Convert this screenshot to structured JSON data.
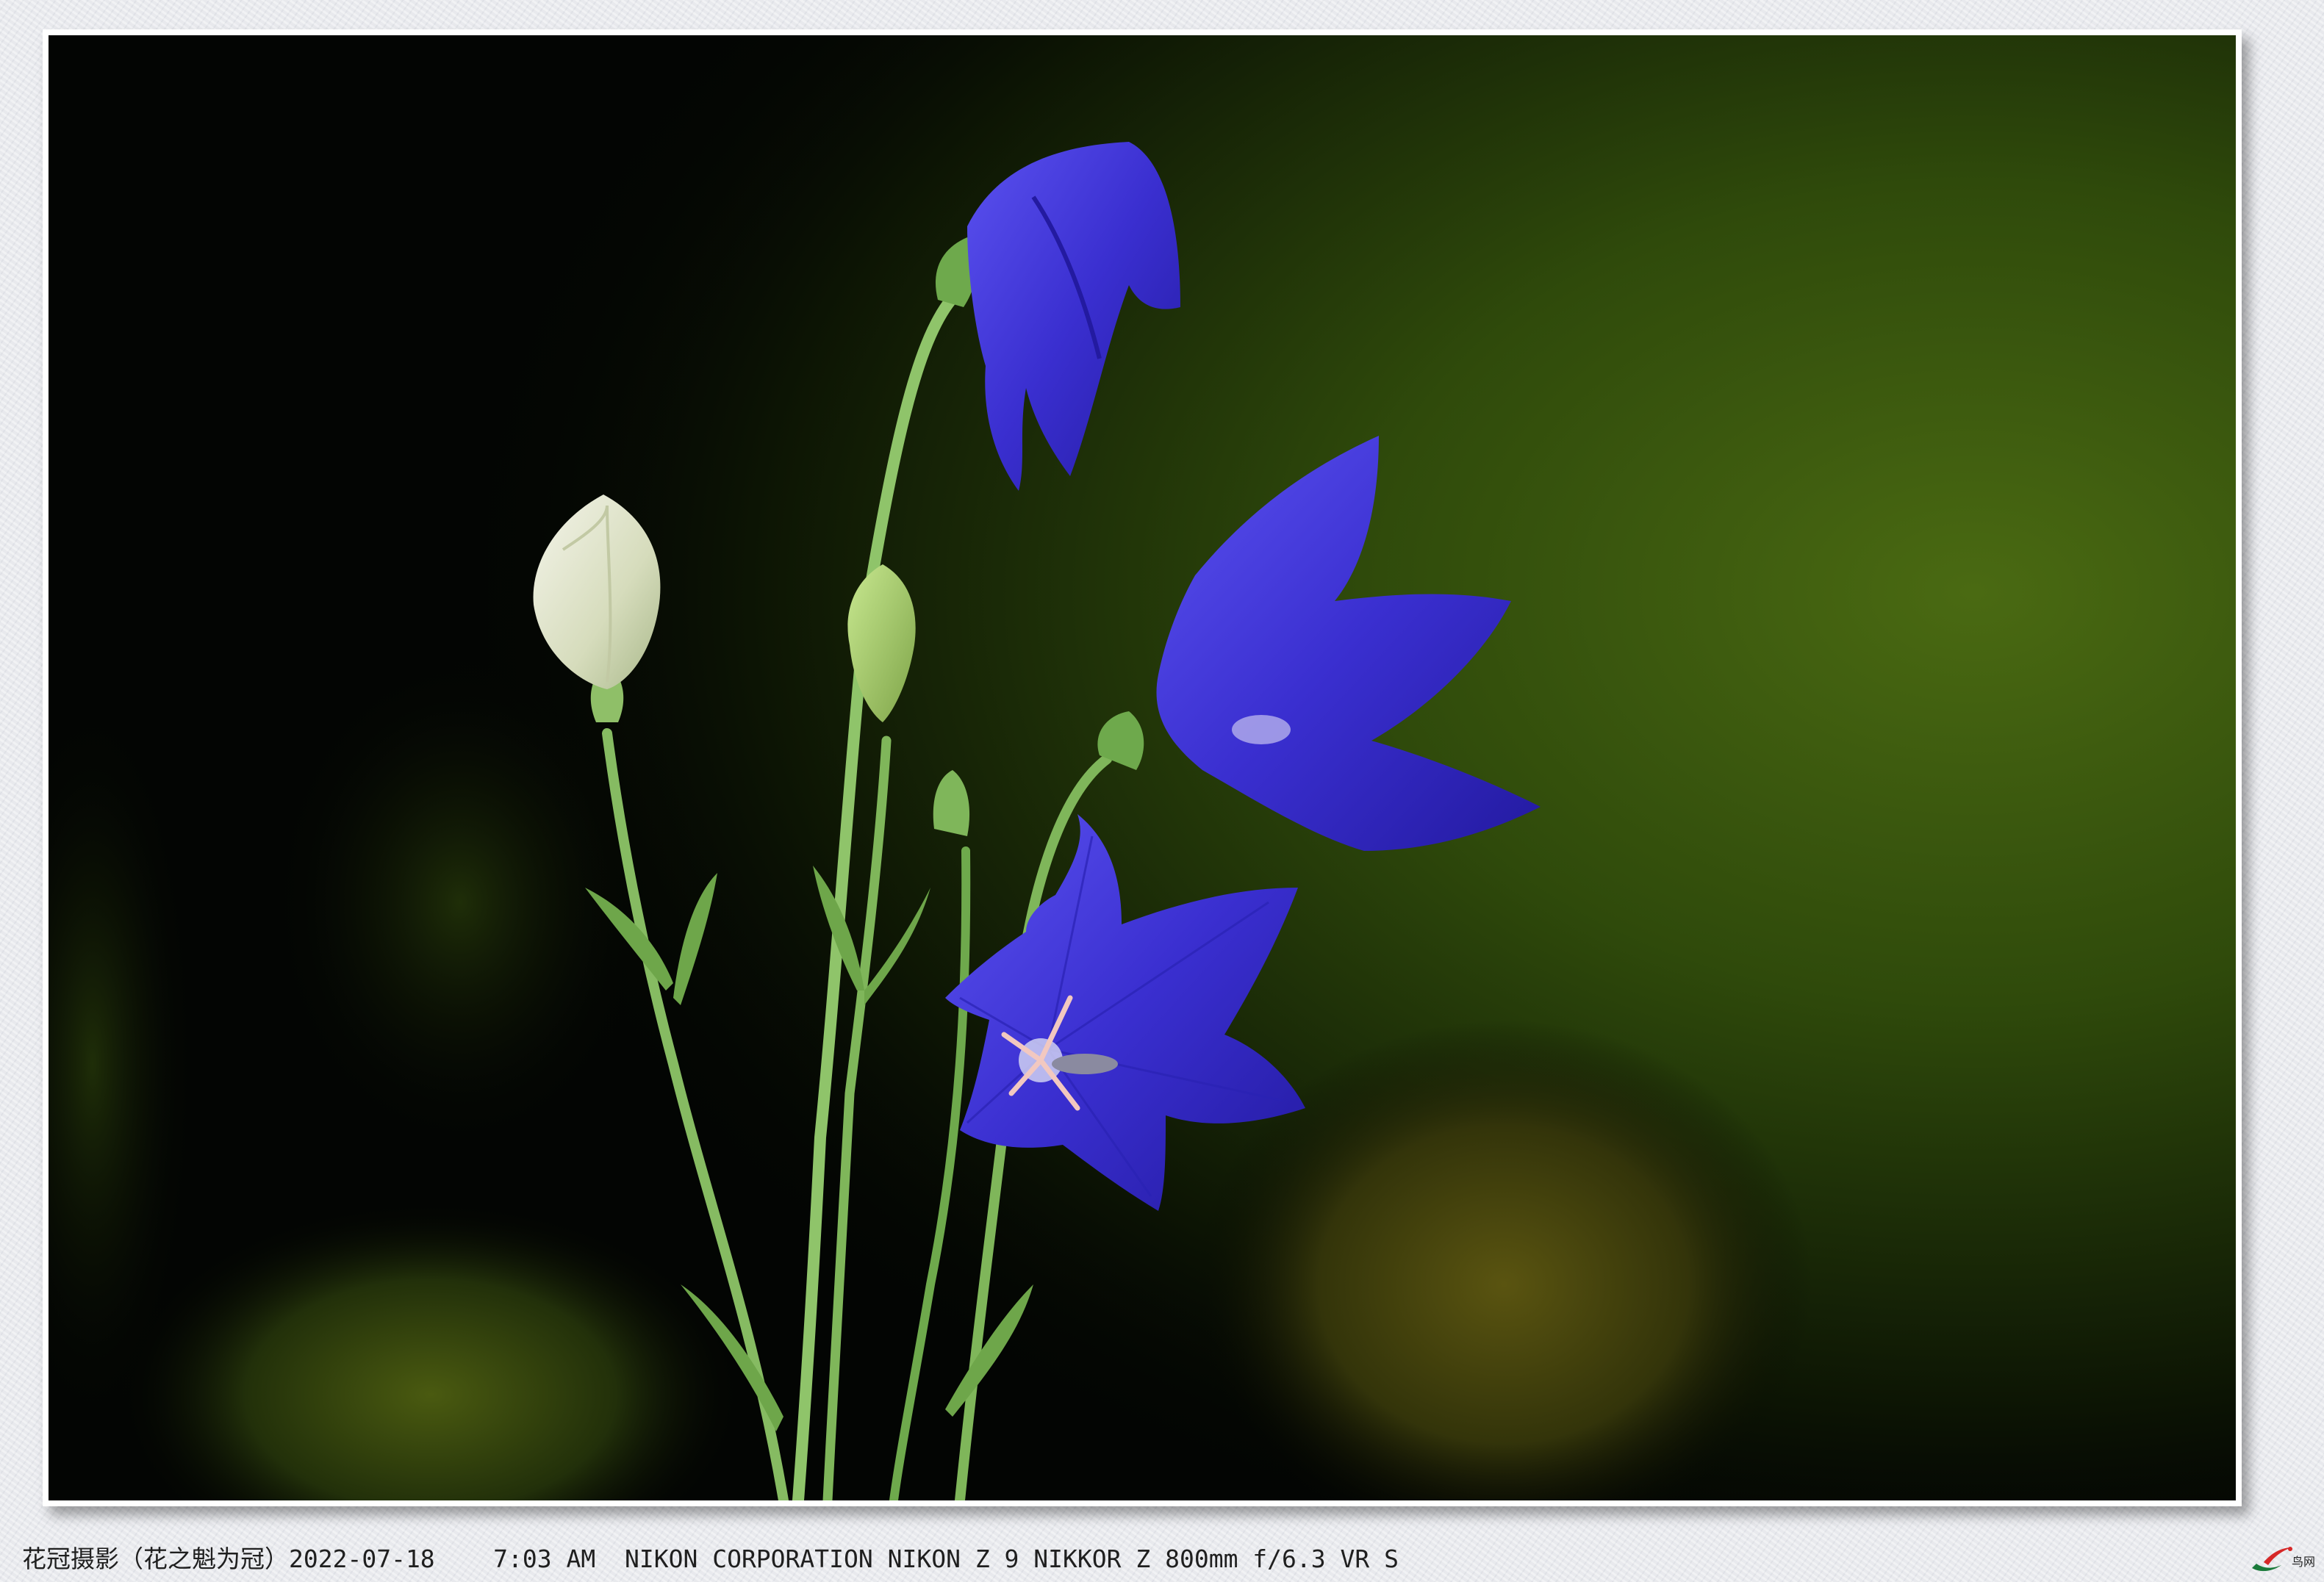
{
  "caption": {
    "author": "花冠摄影（花之魁为冠）",
    "date": "2022-07-18",
    "time": "7:03 AM",
    "camera": "NIKON CORPORATION NIKON Z 9 NIKKOR Z 800mm f/6.3 VR S"
  },
  "watermark": {
    "text": "鸟网"
  },
  "colors": {
    "flower_blue": "#3a2fd0",
    "stem_green": "#8fc46a",
    "background_dark": "#030503",
    "background_green": "#3e5a0c"
  }
}
